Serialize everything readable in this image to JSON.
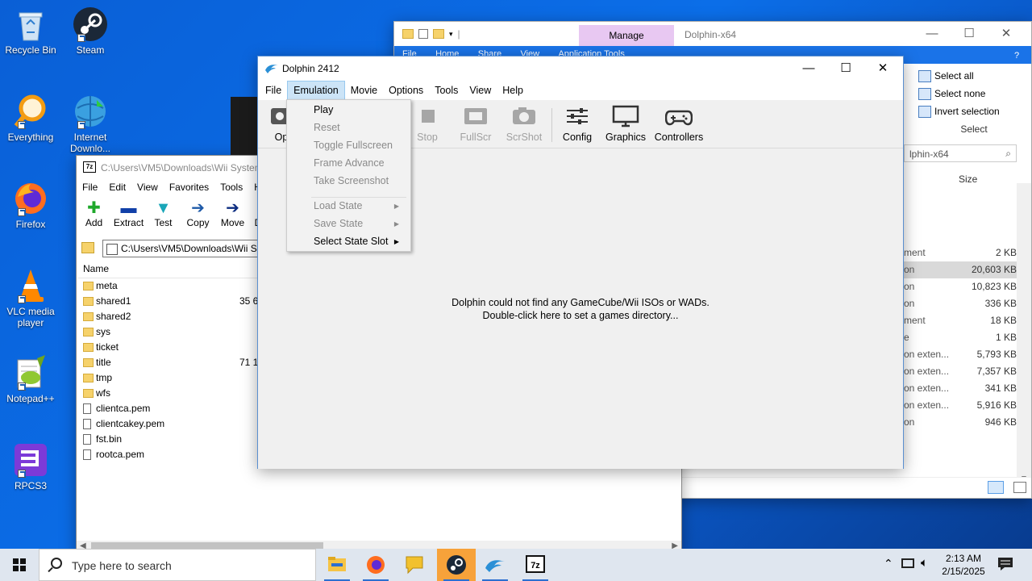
{
  "desktop": {
    "icons": [
      {
        "label": "Recycle Bin",
        "icon": "recycle-bin-icon"
      },
      {
        "label": "Steam",
        "icon": "steam-icon"
      },
      {
        "label": "Everything",
        "icon": "everything-icon"
      },
      {
        "label": "Internet Downlo...",
        "icon": "idm-icon"
      },
      {
        "label": "Firefox",
        "icon": "firefox-icon"
      },
      {
        "label": "VLC media player",
        "icon": "vlc-icon"
      },
      {
        "label": "Notepad++",
        "icon": "notepadpp-icon"
      },
      {
        "label": "RPCS3",
        "icon": "rpcs3-icon"
      }
    ]
  },
  "explorer": {
    "manage_tab": "Manage",
    "title": "Dolphin-x64",
    "tabs": [
      "File",
      "Home",
      "Share",
      "View",
      "Application Tools"
    ],
    "select_group": {
      "select_all": "Select all",
      "select_none": "Select none",
      "invert": "Invert selection",
      "group_label": "Select"
    },
    "search_placeholder": "lphin-x64",
    "column_size": "Size",
    "rows": [
      {
        "type": "ment",
        "size": "2 KB"
      },
      {
        "type": "on",
        "size": "20,603 KB",
        "selected": true
      },
      {
        "type": "on",
        "size": "10,823 KB"
      },
      {
        "type": "on",
        "size": "336 KB"
      },
      {
        "type": "ment",
        "size": "18 KB"
      },
      {
        "type": "e",
        "size": "1 KB"
      },
      {
        "type": "on exten...",
        "size": "5,793 KB"
      },
      {
        "type": "on exten...",
        "size": "7,357 KB"
      },
      {
        "type": "on exten...",
        "size": "341 KB"
      },
      {
        "type": "on exten...",
        "size": "5,916 KB"
      },
      {
        "type": "on",
        "size": "946 KB"
      }
    ]
  },
  "sevenzip": {
    "title": "C:\\Users\\VM5\\Downloads\\Wii System",
    "menu": [
      "File",
      "Edit",
      "View",
      "Favorites",
      "Tools",
      "He"
    ],
    "toolbar": [
      {
        "label": "Add",
        "icon": "add-icon"
      },
      {
        "label": "Extract",
        "icon": "extract-icon"
      },
      {
        "label": "Test",
        "icon": "test-icon"
      },
      {
        "label": "Copy",
        "icon": "copy-icon"
      },
      {
        "label": "Move",
        "icon": "move-icon"
      },
      {
        "label": "D",
        "icon": "delete-icon"
      }
    ],
    "address": "C:\\Users\\VM5\\Downloads\\Wii S",
    "column_name": "Name",
    "items": [
      {
        "name": "meta",
        "kind": "folder",
        "size": ""
      },
      {
        "name": "shared1",
        "kind": "folder",
        "size": "35 65"
      },
      {
        "name": "shared2",
        "kind": "folder",
        "size": ""
      },
      {
        "name": "sys",
        "kind": "folder",
        "size": ""
      },
      {
        "name": "ticket",
        "kind": "folder",
        "size": ""
      },
      {
        "name": "title",
        "kind": "folder",
        "size": "71 11"
      },
      {
        "name": "tmp",
        "kind": "folder",
        "size": ""
      },
      {
        "name": "wfs",
        "kind": "folder",
        "size": ""
      },
      {
        "name": "clientca.pem",
        "kind": "file",
        "size": ""
      },
      {
        "name": "clientcakey.pem",
        "kind": "file",
        "size": ""
      },
      {
        "name": "fst.bin",
        "kind": "file",
        "size": ""
      },
      {
        "name": "rootca.pem",
        "kind": "file",
        "size": ""
      }
    ]
  },
  "dolphin": {
    "title": "Dolphin 2412",
    "menu": [
      "File",
      "Emulation",
      "Movie",
      "Options",
      "Tools",
      "View",
      "Help"
    ],
    "active_menu": "Emulation",
    "toolbar": [
      {
        "label": "Op",
        "icon": "open-icon",
        "enabled": true
      },
      {
        "label": "Stop",
        "icon": "stop-icon",
        "enabled": false
      },
      {
        "label": "FullScr",
        "icon": "fullscreen-icon",
        "enabled": false
      },
      {
        "label": "ScrShot",
        "icon": "screenshot-icon",
        "enabled": false
      },
      {
        "label": "Config",
        "icon": "config-icon",
        "enabled": true
      },
      {
        "label": "Graphics",
        "icon": "graphics-icon",
        "enabled": true
      },
      {
        "label": "Controllers",
        "icon": "controllers-icon",
        "enabled": true
      }
    ],
    "message_line1": "Dolphin could not find any GameCube/Wii ISOs or WADs.",
    "message_line2": "Double-click here to set a games directory...",
    "emulation_menu": [
      {
        "label": "Play",
        "enabled": true
      },
      {
        "label": "Reset",
        "enabled": false
      },
      {
        "label": "Toggle Fullscreen",
        "enabled": false
      },
      {
        "label": "Frame Advance",
        "enabled": false
      },
      {
        "label": "Take Screenshot",
        "enabled": false
      },
      {
        "label": "Load State",
        "enabled": false,
        "submenu": true
      },
      {
        "label": "Save State",
        "enabled": false,
        "submenu": true
      },
      {
        "label": "Select State Slot",
        "enabled": true,
        "submenu": true
      }
    ]
  },
  "taskbar": {
    "search_placeholder": "Type here to search",
    "time": "2:13 AM",
    "date": "2/15/2025",
    "apps": [
      "file-explorer-icon",
      "firefox-icon",
      "chat-icon",
      "steam-icon",
      "dolphin-icon",
      "7zip-icon"
    ],
    "active_app": "steam-icon"
  },
  "colors": {
    "desktop_blue": "#0b6ee8",
    "menu_highlight": "#cce4f7",
    "manage_tab": "#e8c8f2",
    "taskbar": "#dfe6ef",
    "active_taskbar_app": "#f7a23a"
  }
}
